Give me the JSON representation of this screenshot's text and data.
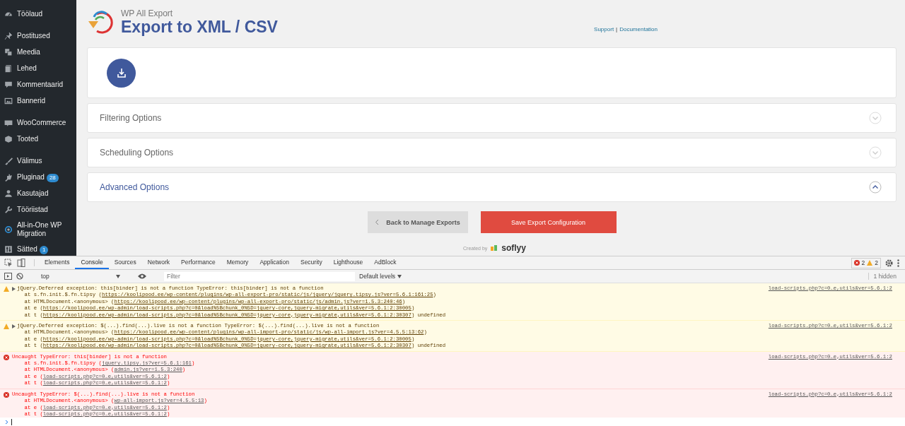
{
  "sidebar": {
    "groups": [
      [
        {
          "label": "Töölaud",
          "kind": "gauge"
        }
      ],
      [
        {
          "label": "Postitused",
          "kind": "pin"
        },
        {
          "label": "Meedia",
          "kind": "media"
        },
        {
          "label": "Lehed",
          "kind": "pages"
        },
        {
          "label": "Kommentaarid",
          "kind": "comment"
        },
        {
          "label": "Bannerid",
          "kind": "banner"
        }
      ],
      [
        {
          "label": "WooCommerce",
          "kind": "woo"
        },
        {
          "label": "Tooted",
          "kind": "box"
        }
      ],
      [
        {
          "label": "Välimus",
          "kind": "brush"
        },
        {
          "label": "Pluginad",
          "kind": "plug",
          "badge": "28"
        },
        {
          "label": "Kasutajad",
          "kind": "user"
        },
        {
          "label": "Tööriistad",
          "kind": "wrench"
        },
        {
          "label": "All-in-One WP Migration",
          "kind": "circle"
        },
        {
          "label": "Sätted",
          "kind": "sliders",
          "badge": "1"
        }
      ]
    ]
  },
  "header": {
    "subtitle": "WP All Export",
    "title": "Export to XML / CSV",
    "links": [
      "Support",
      "Documentation"
    ],
    "separator": "|"
  },
  "sections": [
    {
      "title": "Filtering Options",
      "expanded": false
    },
    {
      "title": "Scheduling Options",
      "expanded": false
    },
    {
      "title": "Advanced Options",
      "expanded": true
    }
  ],
  "buttons": {
    "back": "Back to Manage Exports",
    "save": "Save Export Configuration"
  },
  "footer": {
    "created_by": "Created by",
    "brand": "soflyy"
  },
  "devtools": {
    "tabs": [
      {
        "label": "Elements",
        "selected": false
      },
      {
        "label": "Console",
        "selected": true
      },
      {
        "label": "Sources",
        "selected": false
      },
      {
        "label": "Network",
        "selected": false
      },
      {
        "label": "Performance",
        "selected": false
      },
      {
        "label": "Memory",
        "selected": false
      },
      {
        "label": "Application",
        "selected": false
      },
      {
        "label": "Security",
        "selected": false
      },
      {
        "label": "Lighthouse",
        "selected": false
      },
      {
        "label": "AdBlock",
        "selected": false
      }
    ],
    "error_count": "2",
    "warning_count": "2",
    "context": "top",
    "filter_placeholder": "Filter",
    "levels": "Default levels",
    "hidden": "1 hidden",
    "messages": [
      {
        "kind": "warning",
        "expandable": true,
        "text": "jQuery.Deferred exception: this[binder] is not a function TypeError: this[binder] is not a function",
        "source": "load-scripts.php?c=0…e,utils&ver=5.6.1:2",
        "frames": [
          {
            "prefix": "    at s.fn.init.$.fn.tipsy (",
            "link": "https://koolipood.ee/wp-content/plugins/wp-all-export-pro/static/js/jquery/jquery.tipsy.js?ver=5.6.1:161:25",
            "suffix": ")"
          },
          {
            "prefix": "    at HTMLDocument.<anonymous> (",
            "link": "https://koolipood.ee/wp-content/plugins/wp-all-export-pro/static/js/admin.js?ver=1.5.3:240:46",
            "suffix": ")"
          },
          {
            "prefix": "    at e (",
            "link": "https://koolipood.ee/wp-admin/load-scripts.php?c=0&load%5Bchunk_0%5D=jquery-core,jquery-migrate,utils&ver=5.6.1:2:30005",
            "suffix": ")"
          },
          {
            "prefix": "    at t (",
            "link": "https://koolipood.ee/wp-admin/load-scripts.php?c=0&load%5Bchunk_0%5D=jquery-core,jquery-migrate,utils&ver=5.6.1:2:30307",
            "suffix": ") undefined"
          }
        ]
      },
      {
        "kind": "warning",
        "expandable": true,
        "text": "jQuery.Deferred exception: $(...).find(...).live is not a function TypeError: $(...).find(...).live is not a function",
        "source": "load-scripts.php?c=0…e,utils&ver=5.6.1:2",
        "frames": [
          {
            "prefix": "    at HTMLDocument.<anonymous> (",
            "link": "https://koolipood.ee/wp-content/plugins/wp-all-import-pro/static/js/wp-all-import.js?ver=4.5.5:13:62",
            "suffix": ")"
          },
          {
            "prefix": "    at e (",
            "link": "https://koolipood.ee/wp-admin/load-scripts.php?c=0&load%5Bchunk_0%5D=jquery-core,jquery-migrate,utils&ver=5.6.1:2:30005",
            "suffix": ")"
          },
          {
            "prefix": "    at t (",
            "link": "https://koolipood.ee/wp-admin/load-scripts.php?c=0&load%5Bchunk_0%5D=jquery-core,jquery-migrate,utils&ver=5.6.1:2:30307",
            "suffix": ") undefined"
          }
        ]
      },
      {
        "kind": "error",
        "expandable": false,
        "text": "Uncaught TypeError: this[binder] is not a function",
        "source": "load-scripts.php?c=0…e,utils&ver=5.6.1:2",
        "frames": [
          {
            "prefix": "    at s.fn.init.$.fn.tipsy (",
            "link": "jquery.tipsy.js?ver=5.6.1:161",
            "suffix": ")"
          },
          {
            "prefix": "    at HTMLDocument.<anonymous> (",
            "link": "admin.js?ver=1.5.3:240",
            "suffix": ")"
          },
          {
            "prefix": "    at e (",
            "link": "load-scripts.php?c=0…e,utils&ver=5.6.1:2",
            "suffix": ")"
          },
          {
            "prefix": "    at t (",
            "link": "load-scripts.php?c=0…e,utils&ver=5.6.1:2",
            "suffix": ")"
          }
        ]
      },
      {
        "kind": "error",
        "expandable": false,
        "text": "Uncaught TypeError: $(...).find(...).live is not a function",
        "source": "load-scripts.php?c=0…e,utils&ver=5.6.1:2",
        "frames": [
          {
            "prefix": "    at HTMLDocument.<anonymous> (",
            "link": "wp-all-import.js?ver=4.5.5:13",
            "suffix": ")"
          },
          {
            "prefix": "    at e (",
            "link": "load-scripts.php?c=0…e,utils&ver=5.6.1:2",
            "suffix": ")"
          },
          {
            "prefix": "    at t (",
            "link": "load-scripts.php?c=0…e,utils&ver=5.6.1:2",
            "suffix": ")"
          }
        ]
      }
    ]
  }
}
